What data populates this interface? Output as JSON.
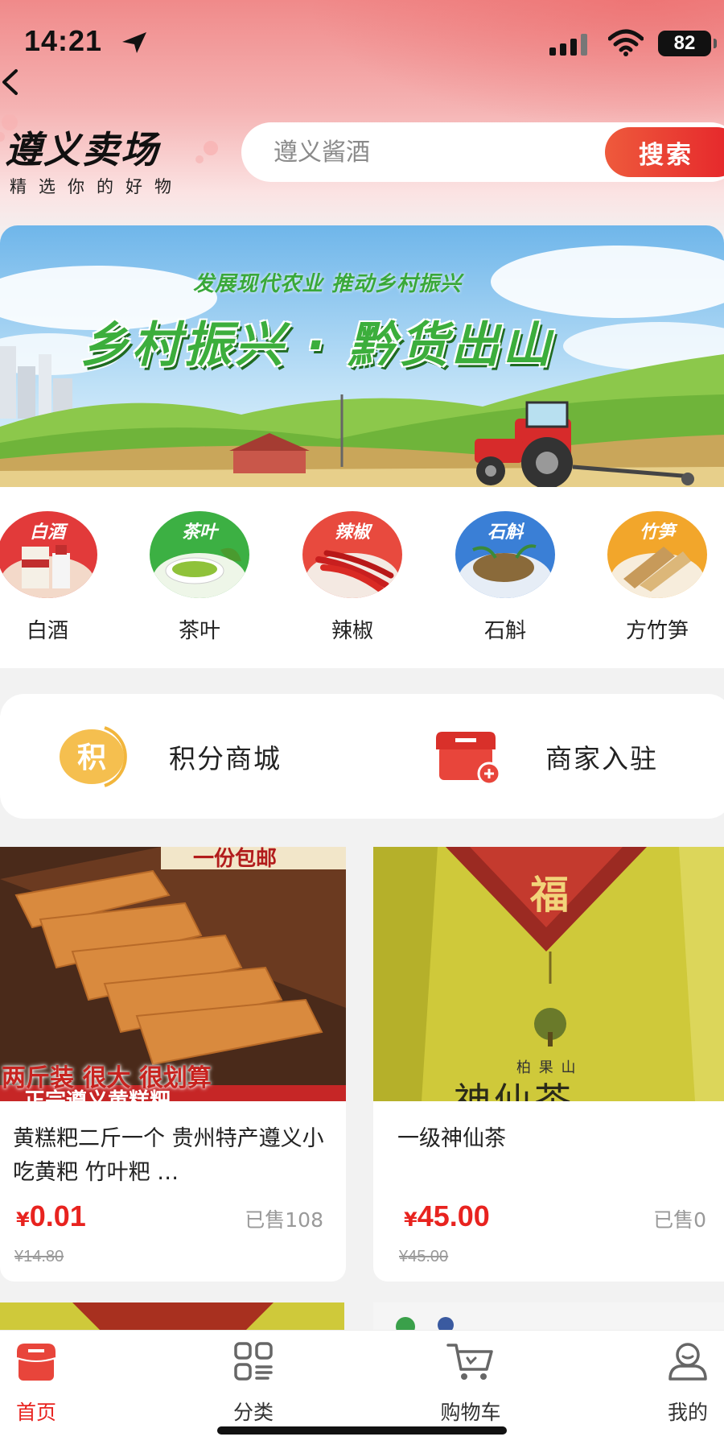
{
  "status_bar": {
    "time": "14:21",
    "battery": "82"
  },
  "header": {
    "brand_title": "遵义卖场",
    "brand_subtitle": "精选你的好物",
    "search_placeholder": "遵义酱酒",
    "search_button": "搜索"
  },
  "banner": {
    "subtitle": "发展现代农业  推动乡村振兴",
    "title": "乡村振兴 · 黔货出山"
  },
  "categories": [
    {
      "label": "白酒",
      "tag": "白酒",
      "icon": "baijiu-icon",
      "color": "#e23a3a"
    },
    {
      "label": "茶叶",
      "tag": "茶叶",
      "icon": "tea-icon",
      "color": "#3cb043"
    },
    {
      "label": "辣椒",
      "tag": "辣椒",
      "icon": "chili-icon",
      "color": "#e84a3e"
    },
    {
      "label": "石斛",
      "tag": "石斛",
      "icon": "dendrobium-icon",
      "color": "#3a7fd6"
    },
    {
      "label": "方竹笋",
      "tag": "竹笋",
      "icon": "bamboo-shoot-icon",
      "color": "#f2a62b"
    }
  ],
  "features": [
    {
      "label": "积分商城",
      "icon_text": "积",
      "icon": "points-icon"
    },
    {
      "label": "商家入驻",
      "icon": "shop-icon"
    }
  ],
  "products": [
    {
      "name": "黄糕粑二斤一个 贵州特产遵义小吃黄粑 竹叶粑 …",
      "currency": "¥",
      "price": "0.01",
      "sold": "已售108",
      "original_price": "¥14.80",
      "img_banner_top": "一份包邮",
      "img_caption": "两斤装 很大 很划算",
      "img_caption2": "正宗遵义黄糕粑"
    },
    {
      "name": "一级神仙茶",
      "currency": "¥",
      "price": "45.00",
      "sold": "已售0",
      "original_price": "¥45.00",
      "img_mark": "福",
      "img_brand": "柏 果 山",
      "img_title": "神仙茶"
    }
  ],
  "tabbar": [
    {
      "label": "首页",
      "icon": "home-icon",
      "active": true
    },
    {
      "label": "分类",
      "icon": "category-icon",
      "active": false
    },
    {
      "label": "购物车",
      "icon": "cart-icon",
      "active": false
    },
    {
      "label": "我的",
      "icon": "profile-icon",
      "active": false
    }
  ],
  "colors": {
    "accent": "#e8231f",
    "header_bg": "#f08a8a",
    "banner_green": "#3cae3c"
  }
}
